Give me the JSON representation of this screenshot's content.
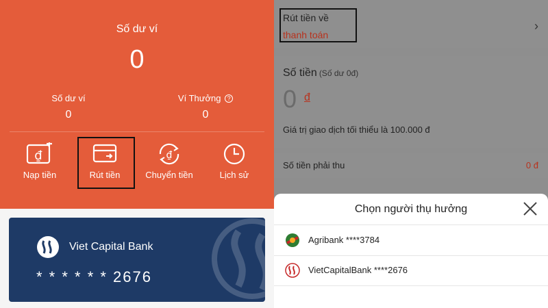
{
  "wallet": {
    "title": "Số dư ví",
    "balance": "0",
    "sub_left_label": "Số dư ví",
    "sub_left_value": "0",
    "sub_right_label": "Ví Thưởng",
    "sub_right_help": "?",
    "sub_right_value": "0",
    "accent_color": "#e45c3a"
  },
  "actions": [
    {
      "label": "Nạp tiền",
      "icon": "deposit-icon"
    },
    {
      "label": "Rút tiền",
      "icon": "withdraw-icon"
    },
    {
      "label": "Chuyển tiền",
      "icon": "transfer-icon"
    },
    {
      "label": "Lịch sử",
      "icon": "clock-icon"
    }
  ],
  "card": {
    "bank_name": "Viet Capital Bank",
    "number": "* * * * * * 2676",
    "color": "#1e3a66"
  },
  "withdraw_form": {
    "method_title": "Rút tiền về",
    "method_value": "thanh toán",
    "amount_title": "Số tiền",
    "amount_sub": "(Số dư 0đ)",
    "amount_value": "0",
    "amount_currency": "đ",
    "min_note": "Giá trị giao dịch tối thiểu là 100.000 đ",
    "receivable_label": "Số tiền phải thu",
    "receivable_value": "0 đ"
  },
  "beneficiary_sheet": {
    "title": "Chọn người thụ hưởng",
    "banks": [
      {
        "name": "Agribank ****3784",
        "icon": "agribank-logo-icon"
      },
      {
        "name": "VietCapitalBank ****2676",
        "icon": "vietcapital-logo-icon"
      }
    ]
  }
}
